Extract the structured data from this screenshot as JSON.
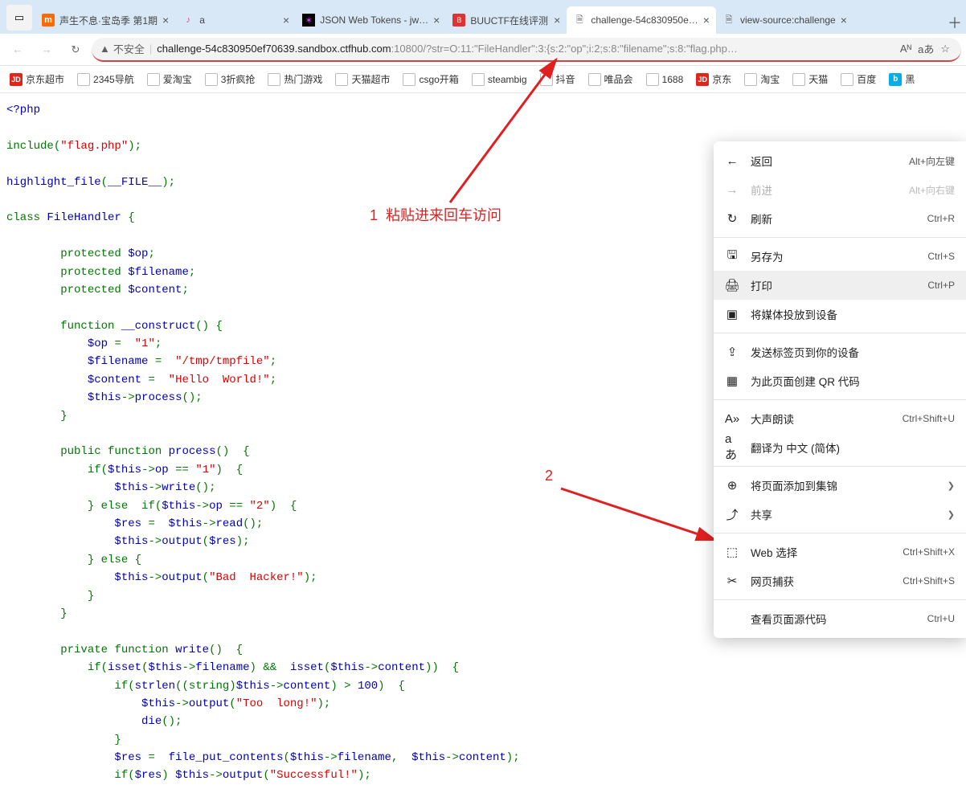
{
  "tabs": [
    {
      "icon": "mgo",
      "label": "声生不息·宝岛季 第1期"
    },
    {
      "icon": "tik",
      "label": "a"
    },
    {
      "icon": "jwt",
      "label": "JSON Web Tokens - jw…"
    },
    {
      "icon": "buu",
      "label": "BUUCTF在线评测"
    },
    {
      "icon": "page",
      "label": "challenge-54c830950e…",
      "active": true
    },
    {
      "icon": "page",
      "label": "view-source:challenge"
    }
  ],
  "addr": {
    "insecure_label": "不安全",
    "host": "challenge-54c830950ef70639.sandbox.ctfhub.com",
    "port": ":10800/",
    "path": "?str=O:11:\"FileHandler\":3:{s:2:\"op\";i:2;s:8:\"filename\";s:8:\"flag.php…",
    "reader": "Aᴺ",
    "translate": "aあ",
    "star": "☆"
  },
  "bookmarks": [
    {
      "icon": "jd",
      "label": "京东超市"
    },
    {
      "icon": "doc",
      "label": "2345导航"
    },
    {
      "icon": "doc",
      "label": "爱淘宝"
    },
    {
      "icon": "doc",
      "label": "3折疯抢"
    },
    {
      "icon": "doc",
      "label": "热门游戏"
    },
    {
      "icon": "doc",
      "label": "天猫超市"
    },
    {
      "icon": "doc",
      "label": "csgo开箱"
    },
    {
      "icon": "doc",
      "label": "steambig"
    },
    {
      "icon": "doc",
      "label": "抖音"
    },
    {
      "icon": "doc",
      "label": "唯品会"
    },
    {
      "icon": "doc",
      "label": "1688"
    },
    {
      "icon": "jd",
      "label": "京东"
    },
    {
      "icon": "doc",
      "label": "淘宝"
    },
    {
      "icon": "doc",
      "label": "天猫"
    },
    {
      "icon": "doc",
      "label": "百度"
    },
    {
      "icon": "bili",
      "label": "黑"
    }
  ],
  "code": {
    "open_tag": "<?php",
    "include": "include",
    "flagphp": "\"flag.php\"",
    "hlf": "highlight_file",
    "file_const": "__FILE__",
    "class_kw": "class ",
    "class_name": "FileHandler",
    "brace_open": " {",
    "prot": "protected ",
    "var_op": "$op",
    "var_fn": "$filename",
    "var_ct": "$content",
    "fn_kw": "function ",
    "construct": "__construct",
    "paren": "()",
    "brace": " {",
    "assign_op": "$op ",
    "eq": "=  ",
    "one": "\"1\"",
    "semi": ";",
    "assign_fn": "$filename ",
    "tmp": "\"/tmp/tmpfile\"",
    "assign_ct": "$content ",
    "hello": "\"Hello  World!\"",
    "this": "$this",
    "arrow": "->",
    "process": "process",
    "public": "public ",
    "process_fn": "process",
    "if": "if(",
    "thisop": "$this",
    "op_prop": "op ",
    "deq": "== ",
    "one2": "\"1\"",
    "close_if": ")  {",
    "write_call": "write",
    "else_if": "} else  if(",
    "two": "\"2\"",
    "res": "$res ",
    "read": "read",
    "output": "output",
    "resvar": "$res",
    "else": "} else {",
    "bad": "\"Bad  Hacker!\"",
    "private": "private ",
    "write_fn": "write",
    "isset": "isset",
    "filename_prop": "filename",
    "and": " &&  ",
    "content_prop": "content",
    "strlen": "strlen",
    "string_cast": "(string)",
    "gt": " > ",
    "hundred": "100",
    "toolong": "\"Too  long!\"",
    "die": "die",
    "fpc": "file_put_contents",
    "success": "\"Successful!\""
  },
  "annotations": {
    "a1_num": "1",
    "a1_text": "粘贴进来回车访问",
    "a2_num": "2"
  },
  "context_menu": [
    {
      "icon": "←",
      "label": "返回",
      "accel": "Alt+向左键"
    },
    {
      "icon": "→",
      "label": "前进",
      "accel": "Alt+向右键",
      "disabled": true
    },
    {
      "icon": "↻",
      "label": "刷新",
      "accel": "Ctrl+R"
    },
    {
      "sep": true
    },
    {
      "icon": "🖫",
      "label": "另存为",
      "accel": "Ctrl+S"
    },
    {
      "icon": "🖨",
      "label": "打印",
      "accel": "Ctrl+P",
      "hover": true
    },
    {
      "icon": "▣",
      "label": "将媒体投放到设备"
    },
    {
      "sep": true
    },
    {
      "icon": "⇪",
      "label": "发送标签页到你的设备"
    },
    {
      "icon": "▦",
      "label": "为此页面创建 QR 代码"
    },
    {
      "sep": true
    },
    {
      "icon": "A»",
      "label": "大声朗读",
      "accel": "Ctrl+Shift+U"
    },
    {
      "icon": "aあ",
      "label": "翻译为 中文 (简体)"
    },
    {
      "sep": true
    },
    {
      "icon": "⊕",
      "label": "将页面添加到集锦",
      "chev": true
    },
    {
      "icon": "⤴",
      "label": "共享",
      "chev": true
    },
    {
      "sep": true
    },
    {
      "icon": "⬚",
      "label": "Web 选择",
      "accel": "Ctrl+Shift+X"
    },
    {
      "icon": "✂",
      "label": "网页捕获",
      "accel": "Ctrl+Shift+S"
    },
    {
      "sep": true
    },
    {
      "icon": "",
      "label": "查看页面源代码",
      "accel": "Ctrl+U"
    }
  ]
}
